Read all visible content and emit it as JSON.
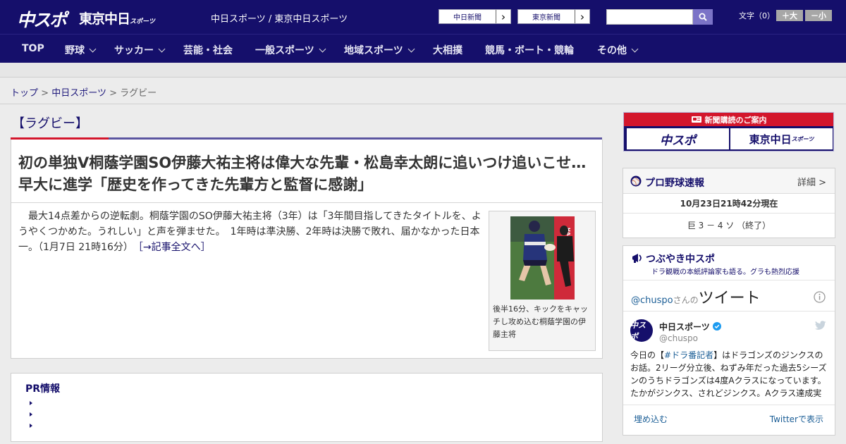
{
  "header": {
    "logo_chuspo": "中スポ",
    "logo_tokyo": "東京中日",
    "logo_tokyo_small": "スポーツ",
    "site_links": "中日スポーツ / 東京中日スポーツ",
    "ext_links": [
      {
        "label": "中日新聞",
        "arrow": "›"
      },
      {
        "label": "東京新聞",
        "arrow": "›"
      }
    ],
    "search_placeholder": "",
    "font_size": {
      "label": "文字（0）",
      "bigger": "＋大",
      "smaller": "－小"
    }
  },
  "nav": [
    {
      "label": "TOP"
    },
    {
      "label": "野球"
    },
    {
      "label": "サッカー"
    },
    {
      "label": "芸能・社会"
    },
    {
      "label": "一般スポーツ"
    },
    {
      "label": "地域スポーツ"
    },
    {
      "label": "大相撲"
    },
    {
      "label": "競馬・ボート・競輪"
    },
    {
      "label": "その他"
    }
  ],
  "breadcrumb": {
    "home": "トップ",
    "sep": ">",
    "section": "中日スポーツ",
    "current": "ラグビー"
  },
  "article": {
    "section_title": "【ラグビー】",
    "headline": "初の単独V桐蔭学園SO伊藤大祐主将は偉大な先輩・松島幸太朗に追いつけ追いこせ…早大に進学「歴史を作ってきた先輩方と監督に感謝」",
    "body": "最大14点差からの逆転劇。桐蔭学園のSO伊藤大祐主将（3年）は「3年間目指してきたタイトルを、ようやくつかめた。うれしい」と声を弾ませた。　1年時は準決勝、2年時は決勝で敗れ、届かなかった日本一。（1月7日 21時16分）",
    "more_link": "［→記事全文へ］",
    "photo_caption": "後半16分、キックをキャッチし攻め込む桐蔭学園の伊藤主将",
    "photo_sign": "HANAZONO"
  },
  "pr": {
    "title": "PR情報"
  },
  "sidebar": {
    "subscription": {
      "title": "新聞購読のご案内",
      "logo_left": "中スポ",
      "logo_right": "東京中日",
      "logo_right_small": "スポーツ"
    },
    "pro_baseball": {
      "title": "プロ野球速報",
      "detail": "詳細 >",
      "time": "10月23日21時42分現在",
      "score": "巨 3 － 4 ソ （終了）"
    },
    "tweets": {
      "title": "つぶやき中スポ",
      "subtitle": "ドラ観戦の本紙評論家も語る。グラも熱烈応援",
      "handle": "@chuspo",
      "handle_suffix": "さんの",
      "heading": "ツイート",
      "account_name": "中日スポーツ",
      "account_user": "@chuspo",
      "avatar_text": "中スポ",
      "tweet_pre": "今日の【",
      "tweet_tag": "#ドラ番記者",
      "tweet_post": "】はドラゴンズのジンクスのお話。2リーグ分立後、ねずみ年だった過去5シーズンのうちドラゴンズは4度Aクラスになっています。たかがジンクス、されどジンクス。Aクラス達成実",
      "embed": "埋め込む",
      "view_on": "Twitterで表示"
    }
  },
  "colors": {
    "brand": "#150f6b",
    "accent_red": "#d3162c",
    "link_blue": "#1b5e96"
  }
}
